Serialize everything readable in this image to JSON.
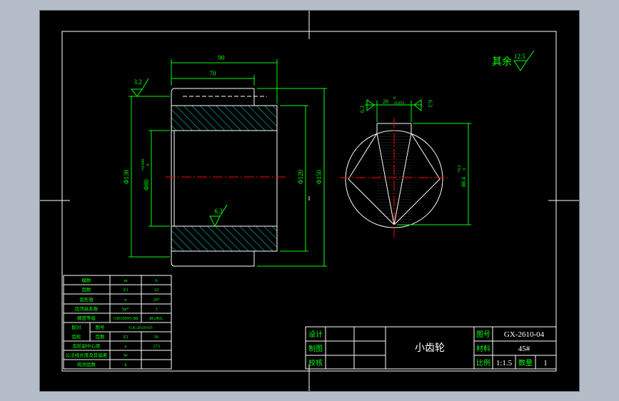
{
  "colors": {
    "background": "#000000",
    "dim": "#00ff00",
    "outline": "#ffffff",
    "center": "#ff0000",
    "hatch": "#00dddd",
    "table_line": "#ffffff",
    "table_text": "#00ff00"
  },
  "drawing": {
    "front_view": {
      "dim_length": "90",
      "dim_hub_length": "70",
      "roughness_top": "3.2",
      "roughness_bore": "6.3",
      "dia_outer": "Φ138",
      "dia_bore_main": "Φ80",
      "dia_bore_tol_upper": "+0.046",
      "dia_bore_tol_lower": "0",
      "dia_hub": "Φ120",
      "dia_max": "Φ150"
    },
    "side_view": {
      "keyway_width": "28",
      "keyway_tol_upper": "0",
      "keyway_tol_lower": "-0.052",
      "roughness_left": "6.3",
      "roughness_right": "6.3",
      "keyway_depth": "88.4",
      "keyway_depth_tol": "+0.2",
      "keyway_depth_tol_lower": "0"
    },
    "general_roughness_label": "其余",
    "general_roughness_value": "12.5"
  },
  "param_table": {
    "rows": [
      [
        "模数",
        "m",
        "6"
      ],
      [
        "齿数",
        "Z1",
        "22"
      ],
      [
        "齿形角",
        "α",
        "20°"
      ],
      [
        "齿顶高系数",
        "ha*",
        "1"
      ],
      [
        "精度等级",
        "GB10095-88",
        "8GJKL"
      ]
    ],
    "pair_label": "配对",
    "pair_gear_label": "齿轮",
    "figure_no_label": "图号",
    "figure_no_value": "GX-2610-03",
    "tooth_count_label": "齿数",
    "tooth_count_sym": "Z2",
    "tooth_count_val": "56",
    "lower_rows": [
      [
        "齿轮副中心距",
        "a",
        "273"
      ],
      [
        "公法线长度及其偏差",
        "W",
        ""
      ],
      [
        "跨测齿数",
        "k",
        ""
      ]
    ]
  },
  "title_block": {
    "design_label": "设计",
    "draw_label": "制图",
    "check_label": "校核",
    "part_name": "小齿轮",
    "figure_no_label": "图号",
    "figure_no_value": "GX-2610-04",
    "material_label": "材料",
    "material_value": "45#",
    "scale_label": "比例",
    "scale_value": "1:1.5",
    "quantity_label": "数量",
    "quantity_value": "1"
  }
}
